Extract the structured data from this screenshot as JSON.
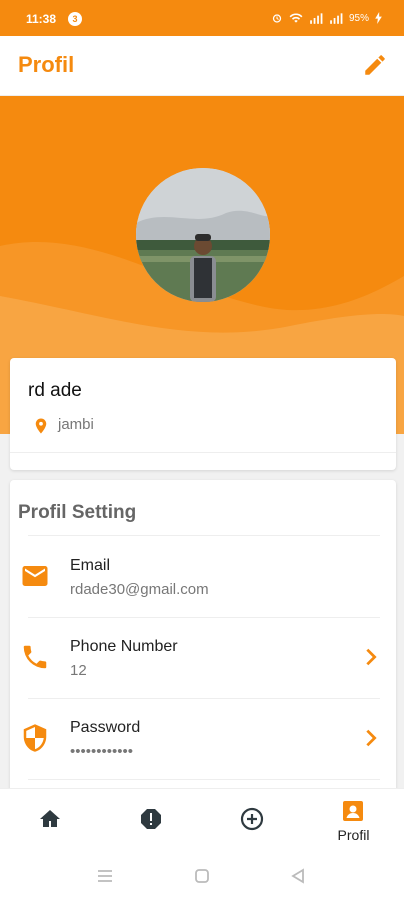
{
  "status_bar": {
    "time": "11:38",
    "notification_count": "3",
    "battery": "95%"
  },
  "app_bar": {
    "title": "Profil"
  },
  "profile": {
    "name": "rd ade",
    "location": "jambi"
  },
  "settings": {
    "title": "Profil Setting",
    "items": [
      {
        "label": "Email",
        "value": "rdade30@gmail.com",
        "icon": "email-icon",
        "chevron": false
      },
      {
        "label": "Phone Number",
        "value": "12",
        "icon": "phone-icon",
        "chevron": true
      },
      {
        "label": "Password",
        "value": "••••••••••••",
        "icon": "shield-icon",
        "chevron": true
      }
    ]
  },
  "bottom_nav": {
    "items": [
      {
        "icon": "home-icon",
        "label": ""
      },
      {
        "icon": "alert-icon",
        "label": ""
      },
      {
        "icon": "add-circle-icon",
        "label": ""
      },
      {
        "icon": "profile-icon",
        "label": "Profil"
      }
    ]
  },
  "colors": {
    "accent": "#f58a0f",
    "text": "#222222",
    "muted": "#777777"
  }
}
